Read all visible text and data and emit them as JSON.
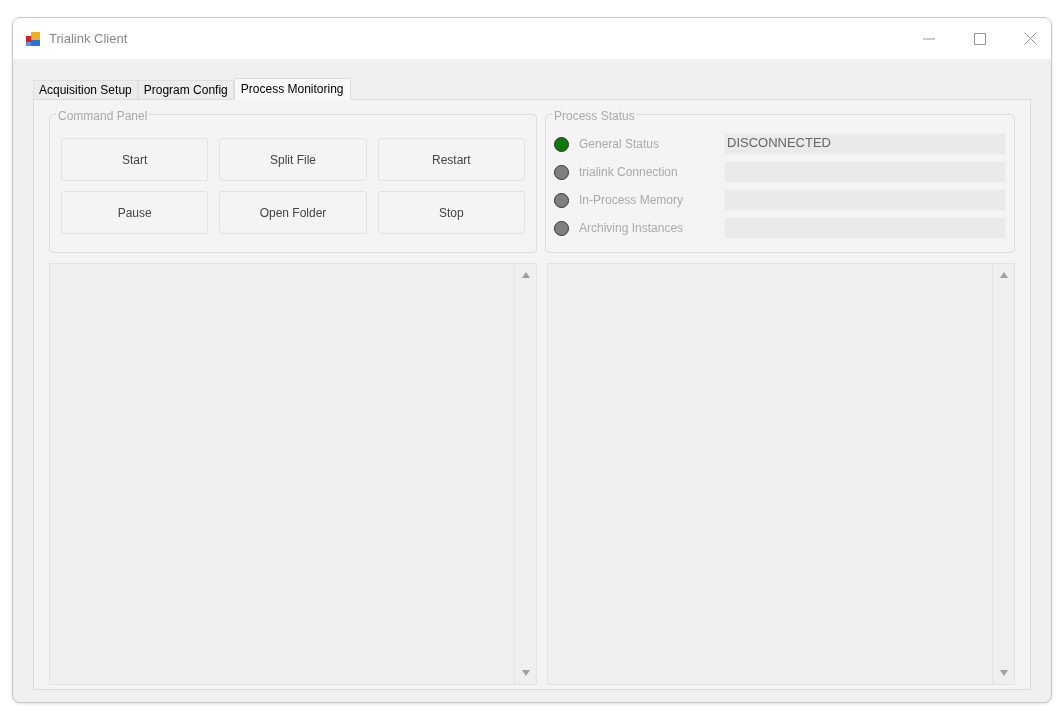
{
  "window": {
    "title": "Trialink Client"
  },
  "tabs": [
    {
      "label": "Acquisition Setup",
      "selected": false
    },
    {
      "label": "Program Config",
      "selected": false
    },
    {
      "label": "Process Monitoring",
      "selected": true
    }
  ],
  "command_panel": {
    "title": "Command Panel",
    "buttons": [
      "Start",
      "Split File",
      "Restart",
      "Pause",
      "Open Folder",
      "Stop"
    ]
  },
  "process_status": {
    "title": "Process Status",
    "rows": [
      {
        "label": "General Status",
        "color": "#0a7a0a",
        "value": "DISCONNECTED"
      },
      {
        "label": "trialink Connection",
        "color": "#808080"
      },
      {
        "label": "In-Process Memory",
        "color": "#808080"
      },
      {
        "label": "Archiving Instances",
        "color": "#808080"
      }
    ]
  }
}
